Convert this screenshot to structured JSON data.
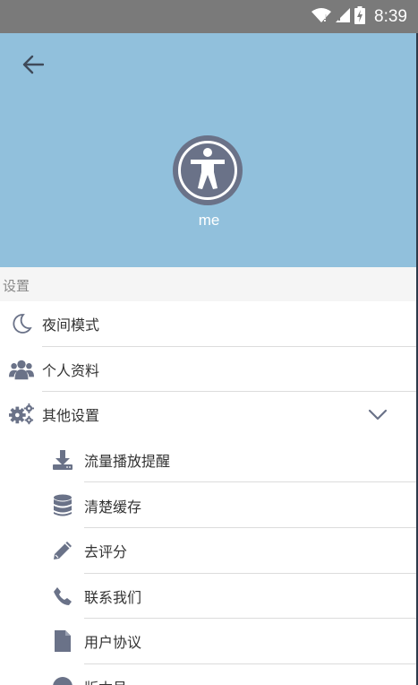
{
  "status_bar": {
    "time": "8:39"
  },
  "header": {
    "username": "me"
  },
  "settings": {
    "section_title": "设置"
  },
  "menu": {
    "night_mode": "夜间模式",
    "profile": "个人资料",
    "other_settings": "其他设置",
    "sub_items": {
      "data_reminder": "流量播放提醒",
      "clear_cache": "清楚缓存",
      "rate": "去评分",
      "contact": "联系我们",
      "agreement": "用户协议",
      "version": "版本号"
    }
  },
  "colors": {
    "header_bg": "#91c0dc",
    "icon": "#6a7288",
    "status_bar": "#7a7a7a"
  }
}
